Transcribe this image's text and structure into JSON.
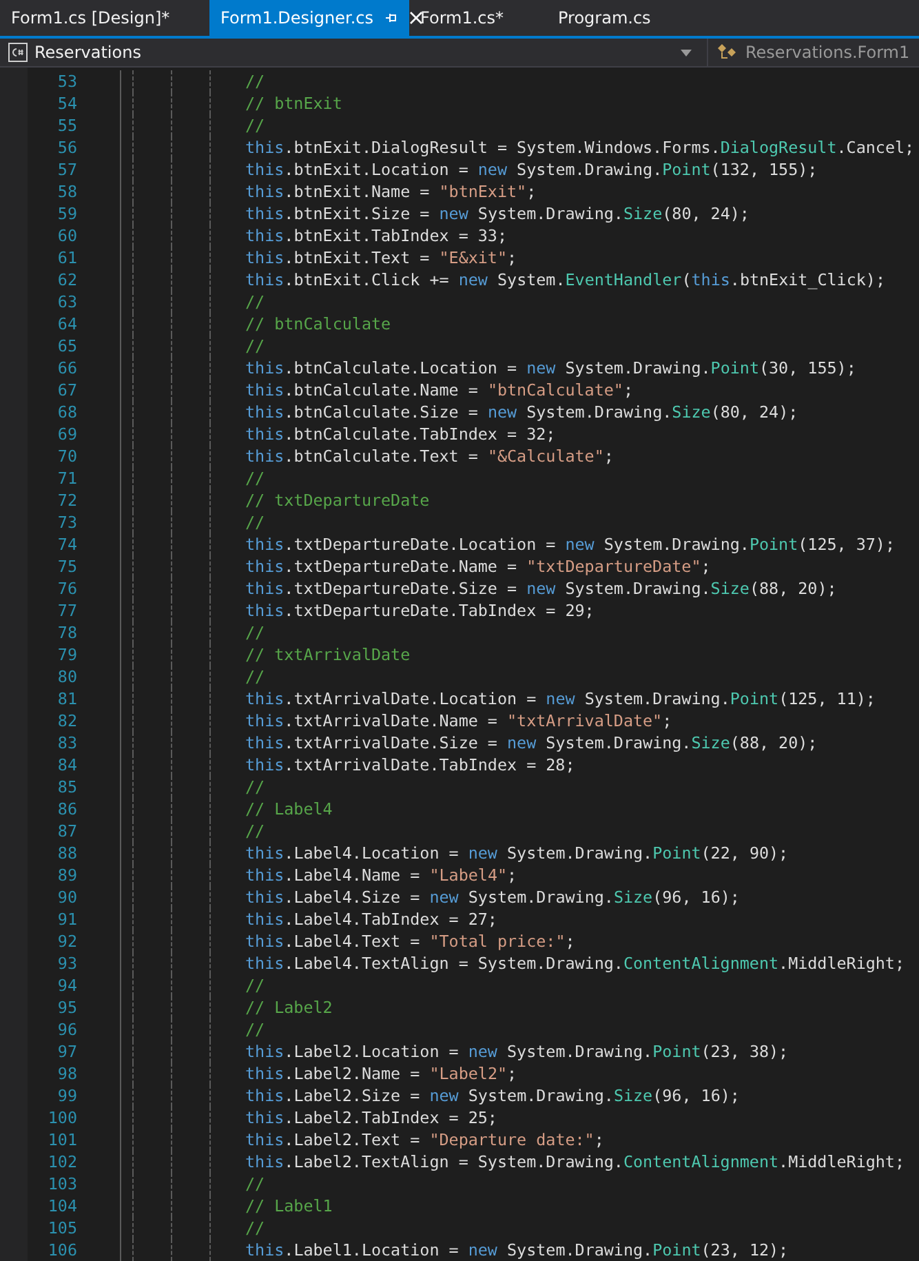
{
  "tabs": [
    {
      "label": "Form1.cs [Design]*",
      "selected": false
    },
    {
      "label": "Form1.Designer.cs",
      "selected": true
    },
    {
      "label": "Form1.cs*",
      "selected": false
    },
    {
      "label": "Program.cs",
      "selected": false
    }
  ],
  "navigation_bar": {
    "project": "Reservations",
    "member": "Reservations.Form1"
  },
  "editor": {
    "lines": [
      {
        "number": "53",
        "tokens": [
          {
            "kind": "comment",
            "text": "//"
          }
        ]
      },
      {
        "number": "54",
        "tokens": [
          {
            "kind": "comment",
            "text": "// btnExit"
          }
        ]
      },
      {
        "number": "55",
        "tokens": [
          {
            "kind": "comment",
            "text": "//"
          }
        ]
      },
      {
        "number": "56",
        "tokens": [
          {
            "kind": "keyword",
            "text": "this"
          },
          {
            "kind": "plain",
            "text": ".btnExit.DialogResult = System.Windows.Forms."
          },
          {
            "kind": "type",
            "text": "DialogResult"
          },
          {
            "kind": "plain",
            "text": ".Cancel;"
          }
        ]
      },
      {
        "number": "57",
        "tokens": [
          {
            "kind": "keyword",
            "text": "this"
          },
          {
            "kind": "plain",
            "text": ".btnExit.Location = "
          },
          {
            "kind": "keyword",
            "text": "new"
          },
          {
            "kind": "plain",
            "text": " System.Drawing."
          },
          {
            "kind": "type",
            "text": "Point"
          },
          {
            "kind": "plain",
            "text": "(132, 155);"
          }
        ]
      },
      {
        "number": "58",
        "tokens": [
          {
            "kind": "keyword",
            "text": "this"
          },
          {
            "kind": "plain",
            "text": ".btnExit.Name = "
          },
          {
            "kind": "string",
            "text": "\"btnExit\""
          },
          {
            "kind": "plain",
            "text": ";"
          }
        ]
      },
      {
        "number": "59",
        "tokens": [
          {
            "kind": "keyword",
            "text": "this"
          },
          {
            "kind": "plain",
            "text": ".btnExit.Size = "
          },
          {
            "kind": "keyword",
            "text": "new"
          },
          {
            "kind": "plain",
            "text": " System.Drawing."
          },
          {
            "kind": "type",
            "text": "Size"
          },
          {
            "kind": "plain",
            "text": "(80, 24);"
          }
        ]
      },
      {
        "number": "60",
        "tokens": [
          {
            "kind": "keyword",
            "text": "this"
          },
          {
            "kind": "plain",
            "text": ".btnExit.TabIndex = 33;"
          }
        ]
      },
      {
        "number": "61",
        "tokens": [
          {
            "kind": "keyword",
            "text": "this"
          },
          {
            "kind": "plain",
            "text": ".btnExit.Text = "
          },
          {
            "kind": "string",
            "text": "\"E&xit\""
          },
          {
            "kind": "plain",
            "text": ";"
          }
        ]
      },
      {
        "number": "62",
        "tokens": [
          {
            "kind": "keyword",
            "text": "this"
          },
          {
            "kind": "plain",
            "text": ".btnExit.Click += "
          },
          {
            "kind": "keyword",
            "text": "new"
          },
          {
            "kind": "plain",
            "text": " System."
          },
          {
            "kind": "type",
            "text": "EventHandler"
          },
          {
            "kind": "plain",
            "text": "("
          },
          {
            "kind": "keyword",
            "text": "this"
          },
          {
            "kind": "plain",
            "text": ".btnExit_Click);"
          }
        ]
      },
      {
        "number": "63",
        "tokens": [
          {
            "kind": "comment",
            "text": "//"
          }
        ]
      },
      {
        "number": "64",
        "tokens": [
          {
            "kind": "comment",
            "text": "// btnCalculate"
          }
        ]
      },
      {
        "number": "65",
        "tokens": [
          {
            "kind": "comment",
            "text": "//"
          }
        ]
      },
      {
        "number": "66",
        "tokens": [
          {
            "kind": "keyword",
            "text": "this"
          },
          {
            "kind": "plain",
            "text": ".btnCalculate.Location = "
          },
          {
            "kind": "keyword",
            "text": "new"
          },
          {
            "kind": "plain",
            "text": " System.Drawing."
          },
          {
            "kind": "type",
            "text": "Point"
          },
          {
            "kind": "plain",
            "text": "(30, 155);"
          }
        ]
      },
      {
        "number": "67",
        "tokens": [
          {
            "kind": "keyword",
            "text": "this"
          },
          {
            "kind": "plain",
            "text": ".btnCalculate.Name = "
          },
          {
            "kind": "string",
            "text": "\"btnCalculate\""
          },
          {
            "kind": "plain",
            "text": ";"
          }
        ]
      },
      {
        "number": "68",
        "tokens": [
          {
            "kind": "keyword",
            "text": "this"
          },
          {
            "kind": "plain",
            "text": ".btnCalculate.Size = "
          },
          {
            "kind": "keyword",
            "text": "new"
          },
          {
            "kind": "plain",
            "text": " System.Drawing."
          },
          {
            "kind": "type",
            "text": "Size"
          },
          {
            "kind": "plain",
            "text": "(80, 24);"
          }
        ]
      },
      {
        "number": "69",
        "tokens": [
          {
            "kind": "keyword",
            "text": "this"
          },
          {
            "kind": "plain",
            "text": ".btnCalculate.TabIndex = 32;"
          }
        ]
      },
      {
        "number": "70",
        "tokens": [
          {
            "kind": "keyword",
            "text": "this"
          },
          {
            "kind": "plain",
            "text": ".btnCalculate.Text = "
          },
          {
            "kind": "string",
            "text": "\"&Calculate\""
          },
          {
            "kind": "plain",
            "text": ";"
          }
        ]
      },
      {
        "number": "71",
        "tokens": [
          {
            "kind": "comment",
            "text": "//"
          }
        ]
      },
      {
        "number": "72",
        "tokens": [
          {
            "kind": "comment",
            "text": "// txtDepartureDate"
          }
        ]
      },
      {
        "number": "73",
        "tokens": [
          {
            "kind": "comment",
            "text": "//"
          }
        ]
      },
      {
        "number": "74",
        "tokens": [
          {
            "kind": "keyword",
            "text": "this"
          },
          {
            "kind": "plain",
            "text": ".txtDepartureDate.Location = "
          },
          {
            "kind": "keyword",
            "text": "new"
          },
          {
            "kind": "plain",
            "text": " System.Drawing."
          },
          {
            "kind": "type",
            "text": "Point"
          },
          {
            "kind": "plain",
            "text": "(125, 37);"
          }
        ]
      },
      {
        "number": "75",
        "tokens": [
          {
            "kind": "keyword",
            "text": "this"
          },
          {
            "kind": "plain",
            "text": ".txtDepartureDate.Name = "
          },
          {
            "kind": "string",
            "text": "\"txtDepartureDate\""
          },
          {
            "kind": "plain",
            "text": ";"
          }
        ]
      },
      {
        "number": "76",
        "tokens": [
          {
            "kind": "keyword",
            "text": "this"
          },
          {
            "kind": "plain",
            "text": ".txtDepartureDate.Size = "
          },
          {
            "kind": "keyword",
            "text": "new"
          },
          {
            "kind": "plain",
            "text": " System.Drawing."
          },
          {
            "kind": "type",
            "text": "Size"
          },
          {
            "kind": "plain",
            "text": "(88, 20);"
          }
        ]
      },
      {
        "number": "77",
        "tokens": [
          {
            "kind": "keyword",
            "text": "this"
          },
          {
            "kind": "plain",
            "text": ".txtDepartureDate.TabIndex = 29;"
          }
        ]
      },
      {
        "number": "78",
        "tokens": [
          {
            "kind": "comment",
            "text": "//"
          }
        ]
      },
      {
        "number": "79",
        "tokens": [
          {
            "kind": "comment",
            "text": "// txtArrivalDate"
          }
        ]
      },
      {
        "number": "80",
        "tokens": [
          {
            "kind": "comment",
            "text": "//"
          }
        ]
      },
      {
        "number": "81",
        "tokens": [
          {
            "kind": "keyword",
            "text": "this"
          },
          {
            "kind": "plain",
            "text": ".txtArrivalDate.Location = "
          },
          {
            "kind": "keyword",
            "text": "new"
          },
          {
            "kind": "plain",
            "text": " System.Drawing."
          },
          {
            "kind": "type",
            "text": "Point"
          },
          {
            "kind": "plain",
            "text": "(125, 11);"
          }
        ]
      },
      {
        "number": "82",
        "tokens": [
          {
            "kind": "keyword",
            "text": "this"
          },
          {
            "kind": "plain",
            "text": ".txtArrivalDate.Name = "
          },
          {
            "kind": "string",
            "text": "\"txtArrivalDate\""
          },
          {
            "kind": "plain",
            "text": ";"
          }
        ]
      },
      {
        "number": "83",
        "tokens": [
          {
            "kind": "keyword",
            "text": "this"
          },
          {
            "kind": "plain",
            "text": ".txtArrivalDate.Size = "
          },
          {
            "kind": "keyword",
            "text": "new"
          },
          {
            "kind": "plain",
            "text": " System.Drawing."
          },
          {
            "kind": "type",
            "text": "Size"
          },
          {
            "kind": "plain",
            "text": "(88, 20);"
          }
        ]
      },
      {
        "number": "84",
        "tokens": [
          {
            "kind": "keyword",
            "text": "this"
          },
          {
            "kind": "plain",
            "text": ".txtArrivalDate.TabIndex = 28;"
          }
        ]
      },
      {
        "number": "85",
        "tokens": [
          {
            "kind": "comment",
            "text": "//"
          }
        ]
      },
      {
        "number": "86",
        "tokens": [
          {
            "kind": "comment",
            "text": "// Label4"
          }
        ]
      },
      {
        "number": "87",
        "tokens": [
          {
            "kind": "comment",
            "text": "//"
          }
        ]
      },
      {
        "number": "88",
        "tokens": [
          {
            "kind": "keyword",
            "text": "this"
          },
          {
            "kind": "plain",
            "text": ".Label4.Location = "
          },
          {
            "kind": "keyword",
            "text": "new"
          },
          {
            "kind": "plain",
            "text": " System.Drawing."
          },
          {
            "kind": "type",
            "text": "Point"
          },
          {
            "kind": "plain",
            "text": "(22, 90);"
          }
        ]
      },
      {
        "number": "89",
        "tokens": [
          {
            "kind": "keyword",
            "text": "this"
          },
          {
            "kind": "plain",
            "text": ".Label4.Name = "
          },
          {
            "kind": "string",
            "text": "\"Label4\""
          },
          {
            "kind": "plain",
            "text": ";"
          }
        ]
      },
      {
        "number": "90",
        "tokens": [
          {
            "kind": "keyword",
            "text": "this"
          },
          {
            "kind": "plain",
            "text": ".Label4.Size = "
          },
          {
            "kind": "keyword",
            "text": "new"
          },
          {
            "kind": "plain",
            "text": " System.Drawing."
          },
          {
            "kind": "type",
            "text": "Size"
          },
          {
            "kind": "plain",
            "text": "(96, 16);"
          }
        ]
      },
      {
        "number": "91",
        "tokens": [
          {
            "kind": "keyword",
            "text": "this"
          },
          {
            "kind": "plain",
            "text": ".Label4.TabIndex = 27;"
          }
        ]
      },
      {
        "number": "92",
        "tokens": [
          {
            "kind": "keyword",
            "text": "this"
          },
          {
            "kind": "plain",
            "text": ".Label4.Text = "
          },
          {
            "kind": "string",
            "text": "\"Total price:\""
          },
          {
            "kind": "plain",
            "text": ";"
          }
        ]
      },
      {
        "number": "93",
        "tokens": [
          {
            "kind": "keyword",
            "text": "this"
          },
          {
            "kind": "plain",
            "text": ".Label4.TextAlign = System.Drawing."
          },
          {
            "kind": "type",
            "text": "ContentAlignment"
          },
          {
            "kind": "plain",
            "text": ".MiddleRight;"
          }
        ]
      },
      {
        "number": "94",
        "tokens": [
          {
            "kind": "comment",
            "text": "//"
          }
        ]
      },
      {
        "number": "95",
        "tokens": [
          {
            "kind": "comment",
            "text": "// Label2"
          }
        ]
      },
      {
        "number": "96",
        "tokens": [
          {
            "kind": "comment",
            "text": "//"
          }
        ]
      },
      {
        "number": "97",
        "tokens": [
          {
            "kind": "keyword",
            "text": "this"
          },
          {
            "kind": "plain",
            "text": ".Label2.Location = "
          },
          {
            "kind": "keyword",
            "text": "new"
          },
          {
            "kind": "plain",
            "text": " System.Drawing."
          },
          {
            "kind": "type",
            "text": "Point"
          },
          {
            "kind": "plain",
            "text": "(23, 38);"
          }
        ]
      },
      {
        "number": "98",
        "tokens": [
          {
            "kind": "keyword",
            "text": "this"
          },
          {
            "kind": "plain",
            "text": ".Label2.Name = "
          },
          {
            "kind": "string",
            "text": "\"Label2\""
          },
          {
            "kind": "plain",
            "text": ";"
          }
        ]
      },
      {
        "number": "99",
        "tokens": [
          {
            "kind": "keyword",
            "text": "this"
          },
          {
            "kind": "plain",
            "text": ".Label2.Size = "
          },
          {
            "kind": "keyword",
            "text": "new"
          },
          {
            "kind": "plain",
            "text": " System.Drawing."
          },
          {
            "kind": "type",
            "text": "Size"
          },
          {
            "kind": "plain",
            "text": "(96, 16);"
          }
        ]
      },
      {
        "number": "100",
        "tokens": [
          {
            "kind": "keyword",
            "text": "this"
          },
          {
            "kind": "plain",
            "text": ".Label2.TabIndex = 25;"
          }
        ]
      },
      {
        "number": "101",
        "tokens": [
          {
            "kind": "keyword",
            "text": "this"
          },
          {
            "kind": "plain",
            "text": ".Label2.Text = "
          },
          {
            "kind": "string",
            "text": "\"Departure date:\""
          },
          {
            "kind": "plain",
            "text": ";"
          }
        ]
      },
      {
        "number": "102",
        "tokens": [
          {
            "kind": "keyword",
            "text": "this"
          },
          {
            "kind": "plain",
            "text": ".Label2.TextAlign = System.Drawing."
          },
          {
            "kind": "type",
            "text": "ContentAlignment"
          },
          {
            "kind": "plain",
            "text": ".MiddleRight;"
          }
        ]
      },
      {
        "number": "103",
        "tokens": [
          {
            "kind": "comment",
            "text": "//"
          }
        ]
      },
      {
        "number": "104",
        "tokens": [
          {
            "kind": "comment",
            "text": "// Label1"
          }
        ]
      },
      {
        "number": "105",
        "tokens": [
          {
            "kind": "comment",
            "text": "//"
          }
        ]
      },
      {
        "number": "106",
        "tokens": [
          {
            "kind": "keyword",
            "text": "this"
          },
          {
            "kind": "plain",
            "text": ".Label1.Location = "
          },
          {
            "kind": "keyword",
            "text": "new"
          },
          {
            "kind": "plain",
            "text": " System.Drawing."
          },
          {
            "kind": "type",
            "text": "Point"
          },
          {
            "kind": "plain",
            "text": "(23, 12);"
          }
        ]
      }
    ]
  }
}
